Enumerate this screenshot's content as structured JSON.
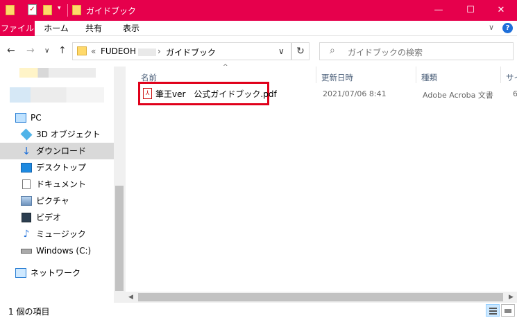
{
  "window": {
    "title": "ガイドブック",
    "controls": {
      "minimize": "—",
      "maximize": "☐",
      "close": "✕"
    },
    "quick_access": {
      "dropdown": "▾"
    }
  },
  "ribbon": {
    "tabs": [
      "ファイル",
      "ホーム",
      "共有",
      "表示"
    ],
    "chevron": "∨",
    "help": "?"
  },
  "nav": {
    "back": "←",
    "forward": "→",
    "recent": "∨",
    "up": "↑",
    "breadcrumb": [
      "«",
      "FUDEOH",
      "›",
      "ガイドブック"
    ],
    "address_dropdown": "∨",
    "refresh": "↻",
    "search_placeholder": "ガイドブックの検索",
    "search_icon": "⌕"
  },
  "navpane": {
    "items": [
      {
        "label": "PC",
        "icon": "pc-icon"
      },
      {
        "label": "3D オブジェクト",
        "icon": "3d-objects-icon"
      },
      {
        "label": "ダウンロード",
        "icon": "download-icon",
        "selected": true
      },
      {
        "label": "デスクトップ",
        "icon": "desktop-icon"
      },
      {
        "label": "ドキュメント",
        "icon": "documents-icon"
      },
      {
        "label": "ピクチャ",
        "icon": "pictures-icon"
      },
      {
        "label": "ビデオ",
        "icon": "videos-icon"
      },
      {
        "label": "ミュージック",
        "icon": "music-icon"
      },
      {
        "label": "Windows (C:)",
        "icon": "drive-icon"
      },
      {
        "label": "ネットワーク",
        "icon": "network-icon"
      }
    ]
  },
  "filelist": {
    "sort_arrow": "^",
    "columns": [
      "名前",
      "更新日時",
      "種類",
      "サイ"
    ],
    "files": [
      {
        "name": "筆王ver　公式ガイドブック.pdf",
        "modified": "2021/07/06 8:41",
        "type": "Adobe Acroba 文書",
        "size": "6"
      }
    ],
    "highlight_color": "#e0001a"
  },
  "status": {
    "item_count": "1 個の項目"
  },
  "colors": {
    "titlebar": "#e6004c",
    "selected": "#d9d9d9",
    "highlight": "#e0001a"
  }
}
